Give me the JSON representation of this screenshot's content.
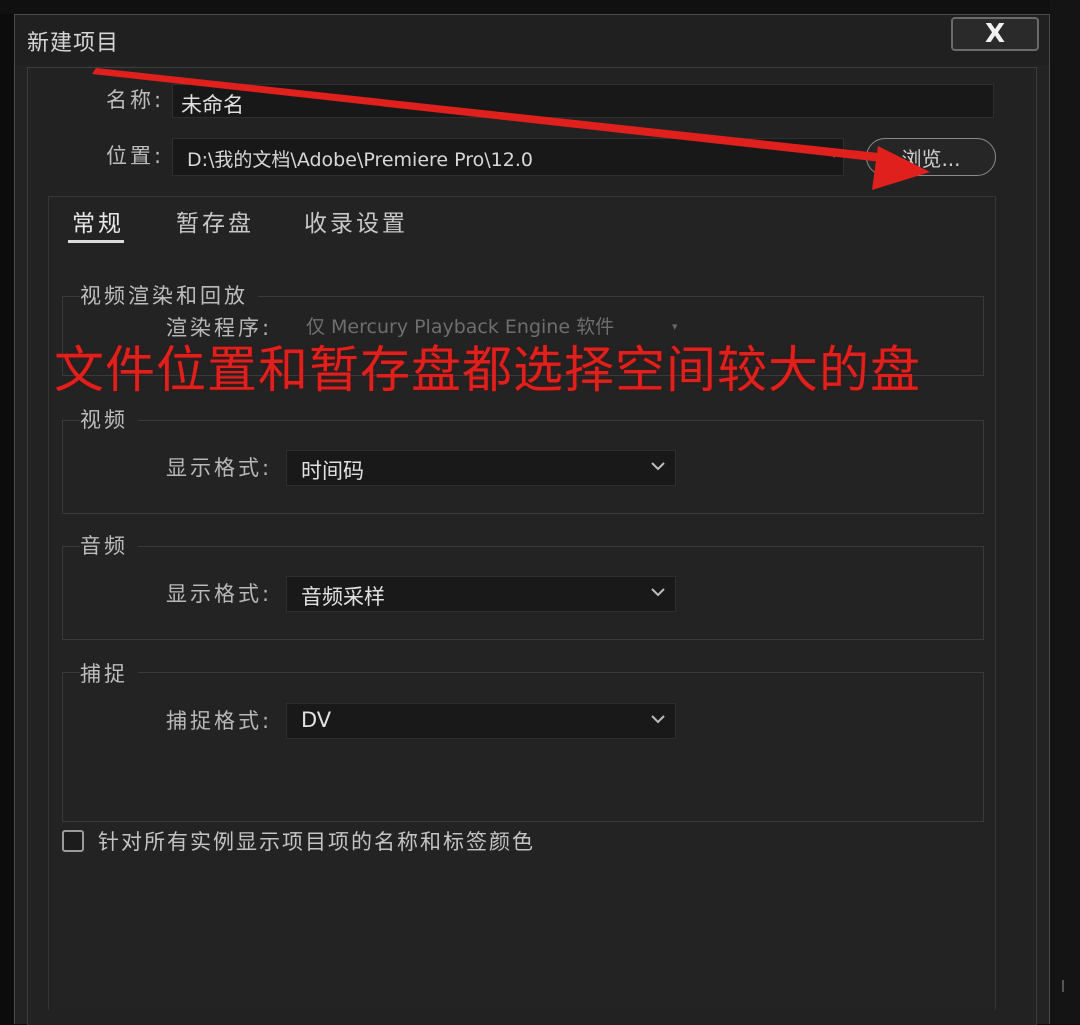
{
  "dialog": {
    "title": "新建项目",
    "close_glyph": "X"
  },
  "name_row": {
    "label": "名称:",
    "value": "未命名"
  },
  "location_row": {
    "label": "位置:",
    "value": "D:\\我的文档\\Adobe\\Premiere Pro\\12.0",
    "browse_label": "浏览..."
  },
  "tabs": [
    {
      "label": "常规",
      "active": true
    },
    {
      "label": "暂存盘",
      "active": false
    },
    {
      "label": "收录设置",
      "active": false
    }
  ],
  "sections": {
    "video_render": {
      "title": "视频渲染和回放",
      "renderer_label": "渲染程序:",
      "renderer_value": "仅 Mercury Playback Engine 软件"
    },
    "video": {
      "title": "视频",
      "format_label": "显示格式:",
      "format_value": "时间码"
    },
    "audio": {
      "title": "音频",
      "format_label": "显示格式:",
      "format_value": "音频采样"
    },
    "capture": {
      "title": "捕捉",
      "format_label": "捕捉格式:",
      "format_value": "DV"
    }
  },
  "checkbox": {
    "label": "针对所有实例显示项目项的名称和标签颜色",
    "checked": false
  },
  "annotation": {
    "text": "文件位置和暂存盘都选择空间较大的盘",
    "color": "#e0201c"
  },
  "colors": {
    "dialog_bg": "#232323",
    "field_bg": "#181818",
    "accent_red": "#e0201c"
  }
}
